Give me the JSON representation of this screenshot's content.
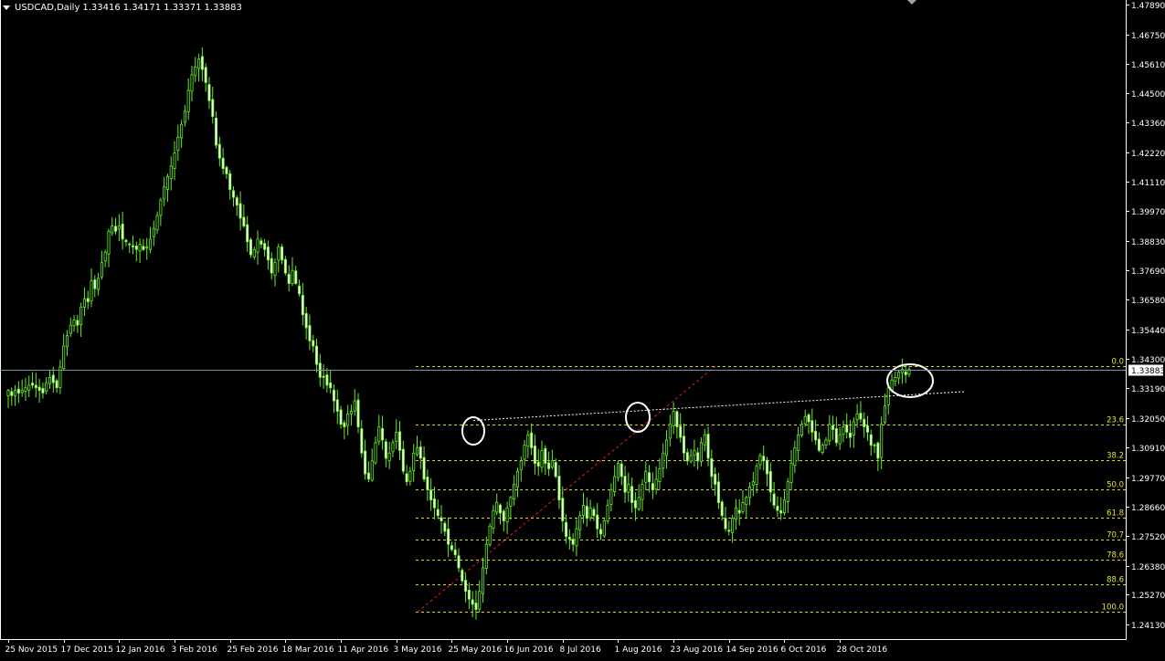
{
  "chart_data": {
    "type": "candlestick",
    "symbol": "USDCAD",
    "timeframe": "Daily",
    "header": {
      "symbol_timeframe": "USDCAD,Daily",
      "open": "1.33416",
      "high": "1.34171",
      "low": "1.33371",
      "close": "1.33883"
    },
    "y_axis": {
      "ticks": [
        "1.47890",
        "1.46750",
        "1.45610",
        "1.44500",
        "1.43360",
        "1.42220",
        "1.41110",
        "1.39970",
        "1.38830",
        "1.37690",
        "1.36580",
        "1.35440",
        "1.34300",
        "1.33190",
        "1.32050",
        "1.30910",
        "1.29770",
        "1.28660",
        "1.27520",
        "1.26380",
        "1.25270",
        "1.24130"
      ],
      "ylim": [
        1.2413,
        1.4789
      ]
    },
    "x_axis": {
      "ticks": [
        "25 Nov 2015",
        "17 Dec 2015",
        "12 Jan 2016",
        "3 Feb 2016",
        "25 Feb 2016",
        "18 Mar 2016",
        "11 Apr 2016",
        "3 May 2016",
        "25 May 2016",
        "16 Jun 2016",
        "8 Jul 2016",
        "1 Aug 2016",
        "23 Aug 2016",
        "14 Sep 2016",
        "6 Oct 2016",
        "28 Oct 2016"
      ]
    },
    "current_price": "1.33883",
    "fibonacci": {
      "start_price": 1.2461,
      "end_price": 1.3403,
      "levels": [
        {
          "label": "0.0",
          "ratio": 0.0
        },
        {
          "label": "23.6",
          "ratio": 0.236
        },
        {
          "label": "38.2",
          "ratio": 0.382
        },
        {
          "label": "50.0",
          "ratio": 0.5
        },
        {
          "label": "61.8",
          "ratio": 0.618
        },
        {
          "label": "70.7",
          "ratio": 0.707
        },
        {
          "label": "78.6",
          "ratio": 0.786
        },
        {
          "label": "88.6",
          "ratio": 0.886
        },
        {
          "label": "100.0",
          "ratio": 1.0
        }
      ]
    },
    "trendline_prices": [
      1.3195,
      1.3285
    ],
    "closes": [
      1.331,
      1.329,
      1.331,
      1.33,
      1.331,
      1.332,
      1.333,
      1.333,
      1.332,
      1.331,
      1.33,
      1.334,
      1.336,
      1.334,
      1.332,
      1.34,
      1.348,
      1.352,
      1.356,
      1.358,
      1.356,
      1.363,
      1.366,
      1.365,
      1.373,
      1.37,
      1.374,
      1.38,
      1.384,
      1.392,
      1.394,
      1.392,
      1.394,
      1.389,
      1.388,
      1.387,
      1.386,
      1.385,
      1.387,
      1.385,
      1.386,
      1.389,
      1.393,
      1.398,
      1.404,
      1.409,
      1.413,
      1.417,
      1.422,
      1.428,
      1.433,
      1.438,
      1.446,
      1.452,
      1.455,
      1.458,
      1.454,
      1.449,
      1.442,
      1.436,
      1.425,
      1.42,
      1.416,
      1.414,
      1.408,
      1.405,
      1.402,
      1.397,
      1.394,
      1.388,
      1.383,
      1.385,
      1.389,
      1.387,
      1.385,
      1.381,
      1.376,
      1.38,
      1.386,
      1.381,
      1.376,
      1.372,
      1.377,
      1.372,
      1.368,
      1.36,
      1.355,
      1.35,
      1.348,
      1.341,
      1.336,
      1.336,
      1.333,
      1.332,
      1.327,
      1.323,
      1.318,
      1.317,
      1.322,
      1.323,
      1.327,
      1.317,
      1.307,
      1.299,
      1.297,
      1.304,
      1.311,
      1.317,
      1.312,
      1.305,
      1.307,
      1.311,
      1.315,
      1.308,
      1.3,
      1.296,
      1.3,
      1.307,
      1.309,
      1.305,
      1.297,
      1.293,
      1.289,
      1.286,
      1.283,
      1.281,
      1.277,
      1.272,
      1.27,
      1.268,
      1.263,
      1.258,
      1.254,
      1.251,
      1.249,
      1.247,
      1.254,
      1.263,
      1.272,
      1.279,
      1.285,
      1.288,
      1.284,
      1.281,
      1.286,
      1.29,
      1.295,
      1.3,
      1.304,
      1.31,
      1.314,
      1.309,
      1.303,
      1.302,
      1.308,
      1.303,
      1.301,
      1.304,
      1.298,
      1.289,
      1.281,
      1.275,
      1.274,
      1.272,
      1.278,
      1.283,
      1.287,
      1.282,
      1.286,
      1.283,
      1.278,
      1.276,
      1.281,
      1.287,
      1.293,
      1.298,
      1.303,
      1.298,
      1.292,
      1.295,
      1.288,
      1.286,
      1.29,
      1.295,
      1.3,
      1.296,
      1.293,
      1.297,
      1.301,
      1.307,
      1.312,
      1.318,
      1.323,
      1.317,
      1.313,
      1.307,
      1.304,
      1.306,
      1.308,
      1.304,
      1.311,
      1.314,
      1.305,
      1.298,
      1.295,
      1.288,
      1.283,
      1.278,
      1.277,
      1.282,
      1.286,
      1.284,
      1.288,
      1.29,
      1.294,
      1.296,
      1.302,
      1.306,
      1.304,
      1.299,
      1.292,
      1.287,
      1.285,
      1.284,
      1.289,
      1.296,
      1.303,
      1.309,
      1.314,
      1.318,
      1.321,
      1.319,
      1.315,
      1.312,
      1.308,
      1.31,
      1.312,
      1.318,
      1.316,
      1.311,
      1.314,
      1.317,
      1.315,
      1.313,
      1.319,
      1.322,
      1.32,
      1.317,
      1.315,
      1.31,
      1.31,
      1.305,
      1.318,
      1.325,
      1.332,
      1.335,
      1.336,
      1.338,
      1.339,
      1.337,
      1.339
    ]
  }
}
